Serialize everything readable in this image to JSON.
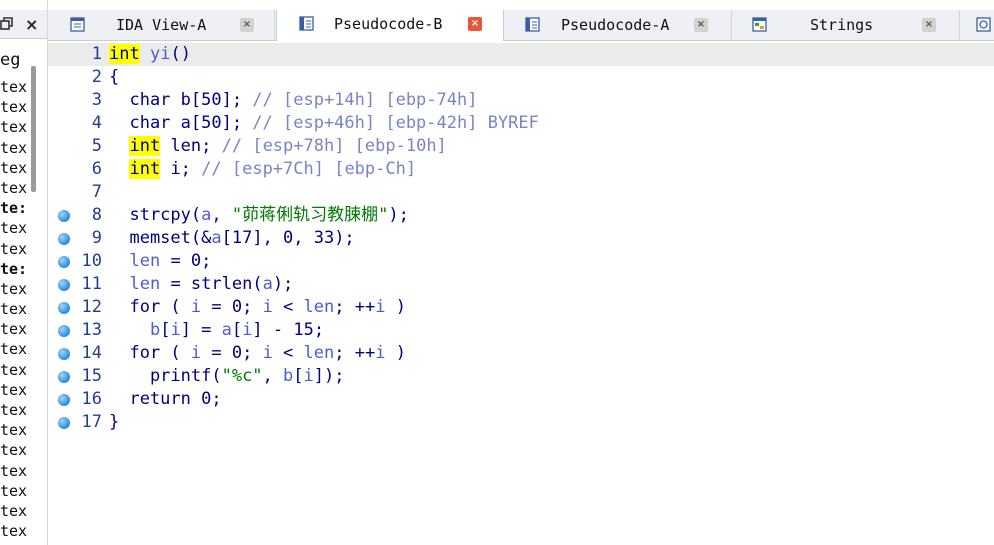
{
  "left_pane": {
    "close_label": "×",
    "partial_title": "eg",
    "items": [
      {
        "text": "tex",
        "bold": false
      },
      {
        "text": "tex",
        "bold": false
      },
      {
        "text": "tex",
        "bold": false
      },
      {
        "text": "tex",
        "bold": false
      },
      {
        "text": "tex",
        "bold": false
      },
      {
        "text": "tex",
        "bold": false
      },
      {
        "text": "te:",
        "bold": true
      },
      {
        "text": "tex",
        "bold": false
      },
      {
        "text": "tex",
        "bold": false
      },
      {
        "text": "te:",
        "bold": true
      },
      {
        "text": "tex",
        "bold": false
      },
      {
        "text": "tex",
        "bold": false
      },
      {
        "text": "tex",
        "bold": false
      },
      {
        "text": "tex",
        "bold": false
      },
      {
        "text": "tex",
        "bold": false
      },
      {
        "text": "tex",
        "bold": false
      },
      {
        "text": "tex",
        "bold": false
      },
      {
        "text": "tex",
        "bold": false
      },
      {
        "text": "tex",
        "bold": false
      },
      {
        "text": "tex",
        "bold": false
      },
      {
        "text": "tex",
        "bold": false
      },
      {
        "text": "tex",
        "bold": false
      },
      {
        "text": "tex",
        "bold": false
      }
    ]
  },
  "tabs": [
    {
      "label": "IDA View-A",
      "icon": "disassembly-view-icon",
      "active": false,
      "close": "×"
    },
    {
      "label": "Pseudocode-B",
      "icon": "pseudocode-icon",
      "active": true,
      "close": "×"
    },
    {
      "label": "Pseudocode-A",
      "icon": "pseudocode-icon",
      "active": false,
      "close": "×"
    },
    {
      "label": "Strings",
      "icon": "strings-icon",
      "active": false,
      "close": "×"
    }
  ],
  "code": {
    "lines": [
      {
        "n": "1",
        "bp": false,
        "tokens": [
          [
            "type_hl",
            "int"
          ],
          [
            "plain",
            " "
          ],
          [
            "var",
            "yi"
          ],
          [
            "plain",
            "()"
          ]
        ]
      },
      {
        "n": "2",
        "bp": false,
        "tokens": [
          [
            "plain",
            "{"
          ]
        ]
      },
      {
        "n": "3",
        "bp": false,
        "tokens": [
          [
            "plain",
            "  char b[50]; "
          ],
          [
            "comment",
            "// [esp+14h] [ebp-74h]"
          ]
        ]
      },
      {
        "n": "4",
        "bp": false,
        "tokens": [
          [
            "plain",
            "  char a[50]; "
          ],
          [
            "comment",
            "// [esp+46h] [ebp-42h] BYREF"
          ]
        ]
      },
      {
        "n": "5",
        "bp": false,
        "tokens": [
          [
            "plain",
            "  "
          ],
          [
            "type_hl",
            "int"
          ],
          [
            "plain",
            " len; "
          ],
          [
            "comment",
            "// [esp+78h] [ebp-10h]"
          ]
        ]
      },
      {
        "n": "6",
        "bp": false,
        "tokens": [
          [
            "plain",
            "  "
          ],
          [
            "type_hl",
            "int"
          ],
          [
            "plain",
            " i; "
          ],
          [
            "comment",
            "// [esp+7Ch] [ebp-Ch]"
          ]
        ]
      },
      {
        "n": "7",
        "bp": false,
        "tokens": []
      },
      {
        "n": "8",
        "bp": true,
        "tokens": [
          [
            "plain",
            "  strcpy("
          ],
          [
            "var",
            "a"
          ],
          [
            "plain",
            ", "
          ],
          [
            "str",
            "\"茆蒋俐轨习教脨棚\""
          ],
          [
            "plain",
            ");"
          ]
        ]
      },
      {
        "n": "9",
        "bp": true,
        "tokens": [
          [
            "plain",
            "  memset(&"
          ],
          [
            "var",
            "a"
          ],
          [
            "plain",
            "[17], 0, 33);"
          ]
        ]
      },
      {
        "n": "10",
        "bp": true,
        "tokens": [
          [
            "plain",
            "  "
          ],
          [
            "var",
            "len"
          ],
          [
            "plain",
            " = 0;"
          ]
        ]
      },
      {
        "n": "11",
        "bp": true,
        "tokens": [
          [
            "plain",
            "  "
          ],
          [
            "var",
            "len"
          ],
          [
            "plain",
            " = strlen("
          ],
          [
            "var",
            "a"
          ],
          [
            "plain",
            ");"
          ]
        ]
      },
      {
        "n": "12",
        "bp": true,
        "tokens": [
          [
            "plain",
            "  for ( "
          ],
          [
            "var",
            "i"
          ],
          [
            "plain",
            " = 0; "
          ],
          [
            "var",
            "i"
          ],
          [
            "plain",
            " < "
          ],
          [
            "var",
            "len"
          ],
          [
            "plain",
            "; ++"
          ],
          [
            "var",
            "i"
          ],
          [
            "plain",
            " )"
          ]
        ]
      },
      {
        "n": "13",
        "bp": true,
        "tokens": [
          [
            "plain",
            "    "
          ],
          [
            "var",
            "b"
          ],
          [
            "plain",
            "["
          ],
          [
            "var",
            "i"
          ],
          [
            "plain",
            "] = "
          ],
          [
            "var",
            "a"
          ],
          [
            "plain",
            "["
          ],
          [
            "var",
            "i"
          ],
          [
            "plain",
            "] - 15;"
          ]
        ]
      },
      {
        "n": "14",
        "bp": true,
        "tokens": [
          [
            "plain",
            "  for ( "
          ],
          [
            "var",
            "i"
          ],
          [
            "plain",
            " = 0; "
          ],
          [
            "var",
            "i"
          ],
          [
            "plain",
            " < "
          ],
          [
            "var",
            "len"
          ],
          [
            "plain",
            "; ++"
          ],
          [
            "var",
            "i"
          ],
          [
            "plain",
            " )"
          ]
        ]
      },
      {
        "n": "15",
        "bp": true,
        "tokens": [
          [
            "plain",
            "    printf("
          ],
          [
            "str",
            "\"%c\""
          ],
          [
            "plain",
            ", "
          ],
          [
            "var",
            "b"
          ],
          [
            "plain",
            "["
          ],
          [
            "var",
            "i"
          ],
          [
            "plain",
            "]);"
          ]
        ]
      },
      {
        "n": "16",
        "bp": true,
        "tokens": [
          [
            "plain",
            "  return 0;"
          ]
        ]
      },
      {
        "n": "17",
        "bp": true,
        "tokens": [
          [
            "plain",
            "}"
          ]
        ]
      }
    ]
  },
  "colors": {
    "accent_close_active": "#e8543c",
    "type_highlight": "#ffff00",
    "breakpoint": "#2f8fdf",
    "string": "#007a00",
    "variable": "#4d5cd6",
    "comment": "#7b83c9"
  }
}
